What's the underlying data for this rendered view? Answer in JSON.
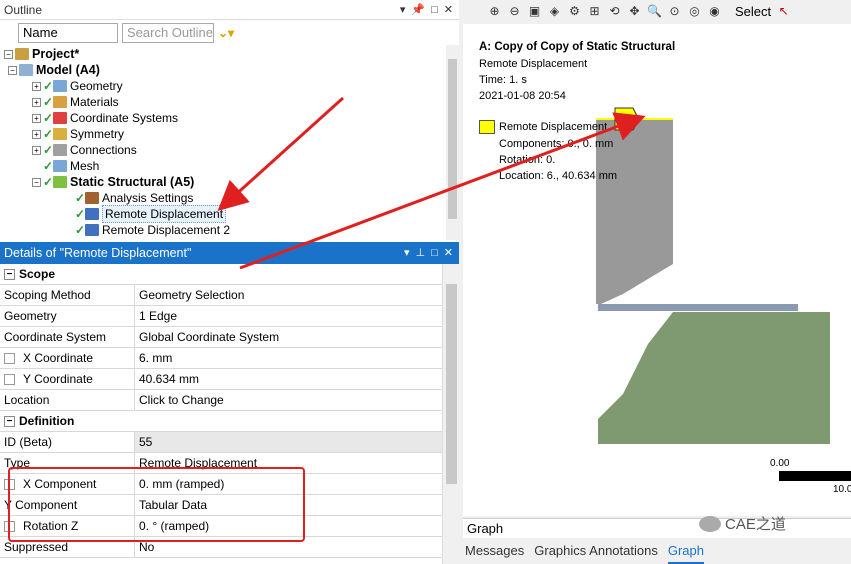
{
  "outline": {
    "title": "Outline",
    "name_combo": "Name",
    "search_placeholder": "Search Outline",
    "tree": [
      {
        "label": "Project*",
        "bold": true
      },
      {
        "label": "Model (A4)",
        "bold": true
      },
      {
        "label": "Geometry"
      },
      {
        "label": "Materials"
      },
      {
        "label": "Coordinate Systems"
      },
      {
        "label": "Symmetry"
      },
      {
        "label": "Connections"
      },
      {
        "label": "Mesh"
      },
      {
        "label": "Static Structural (A5)",
        "bold": true
      },
      {
        "label": "Analysis Settings"
      },
      {
        "label": "Remote Displacement",
        "selected": true
      },
      {
        "label": "Remote Displacement 2"
      }
    ]
  },
  "details": {
    "title": "Details of \"Remote Displacement\"",
    "rows": [
      {
        "key": "Scope",
        "group": true
      },
      {
        "key": "Scoping Method",
        "value": "Geometry Selection"
      },
      {
        "key": "Geometry",
        "value": "1 Edge"
      },
      {
        "key": "Coordinate System",
        "value": "Global Coordinate System"
      },
      {
        "key": "X Coordinate",
        "value": "6. mm",
        "checkbox": true
      },
      {
        "key": "Y Coordinate",
        "value": "40.634 mm",
        "checkbox": true
      },
      {
        "key": "Location",
        "value": "Click to Change"
      },
      {
        "key": "Definition",
        "group": true
      },
      {
        "key": "ID (Beta)",
        "value": "55",
        "grey": true
      },
      {
        "key": "Type",
        "value": "Remote Displacement"
      },
      {
        "key": "X Component",
        "value": "0. mm  (ramped)",
        "checkbox": true
      },
      {
        "key": "Y Component",
        "value": "Tabular Data"
      },
      {
        "key": "Rotation Z",
        "value": "0. °  (ramped)",
        "checkbox": true
      },
      {
        "key": "Suppressed",
        "value": "No"
      }
    ]
  },
  "toolbar": {
    "select_label": "Select"
  },
  "viewport": {
    "title": "A: Copy of Copy of Static Structural",
    "subtitle": "Remote Displacement",
    "time": "Time: 1. s",
    "date": "2021-01-08 20:54",
    "legend_name": "Remote Displacement",
    "legend_components": "Components: 0., 0. mm",
    "legend_rotation": "Rotation: 0.",
    "legend_location": "Location: 6., 40.634 mm",
    "scale_min": "0.00",
    "scale_max": "10.0"
  },
  "bottom": {
    "graph_label": "Graph",
    "tabs": [
      "Messages",
      "Graphics Annotations",
      "Graph"
    ],
    "active_tab": "Graph",
    "watermark": "CAE之道"
  },
  "colors": {
    "accent": "#1a73c9",
    "punch": "#999999",
    "die": "#7f9a70",
    "sheet": "#8a9ab0",
    "highlight": "#e02020"
  }
}
